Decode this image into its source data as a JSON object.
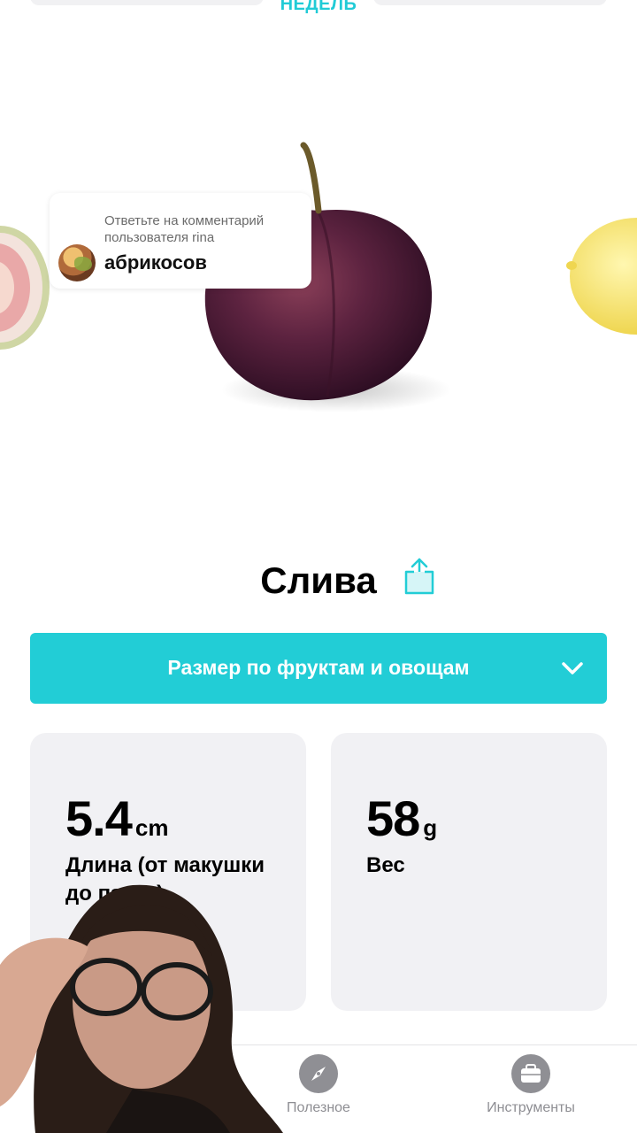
{
  "header": {
    "partial_label": "НЕДЕЛЬ"
  },
  "comment": {
    "reply_hint": "Ответьте на комментарий пользователя rina",
    "text": "абрикосов"
  },
  "fruit": {
    "name": "Слива"
  },
  "size_selector": {
    "label": "Размер по фруктам и овощам"
  },
  "stats": {
    "length": {
      "value": "5.4",
      "unit": "cm",
      "label": "Длина (от макушки до пяток)"
    },
    "weight": {
      "value": "58",
      "unit": "g",
      "label": "Вес"
    }
  },
  "bottom_nav": [
    {
      "label": "Полезное",
      "icon": "compass-icon"
    },
    {
      "label": "Инструменты",
      "icon": "briefcase-icon"
    }
  ],
  "colors": {
    "accent": "#22cdd6",
    "card_bg": "#f1f1f4",
    "nav_icon": "#8f8f94"
  }
}
